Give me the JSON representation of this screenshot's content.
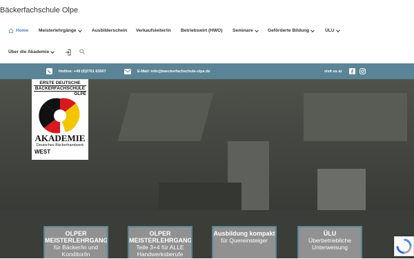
{
  "site_title": "Bäckerfachschule Olpe",
  "nav": {
    "home": "Home",
    "meisterlehrgaenge": "Meisterlehrgänge",
    "ausbilderschein": "Ausbilderschein",
    "verkaufsleiter": "Verkaufsleiter/in",
    "betriebswirt": "Betriebswirt (HWO)",
    "seminare": "Seminare",
    "gefoerderte": "Geförderte Bildung",
    "ulu": "ÜLU",
    "akademie": "Über die Akademie"
  },
  "topbar": {
    "hotline": "Hotline: +49 (0)2761 63507",
    "email": "E-Mail: info@baeckerfachschule-olpe.de",
    "visit": "visit us at"
  },
  "logo": {
    "line1": "ERSTE DEUTSCHE",
    "line2": "BÄCKERFACHSCHULE",
    "line3": "OLPE",
    "akademie": "AKADEMIE",
    "sub": "Deutsches Bäckerhandwerk",
    "west": "WEST"
  },
  "cards": [
    {
      "title": "OLPER MEISTERLEHRGANG",
      "sub": "für Bäcker/in und Konditor/in"
    },
    {
      "title": "OLPER MEISTERLEHRGANG",
      "sub": "Teile 3+4 für ALLE Handwerksberufe"
    },
    {
      "title": "Ausbildung kompakt",
      "sub": "für Quereinsteiger"
    },
    {
      "title": "ÜLU",
      "sub": "Überbetriebliche Unterweisung"
    }
  ],
  "colors": {
    "accent": "#5b8496",
    "link": "#4a7fb0"
  }
}
